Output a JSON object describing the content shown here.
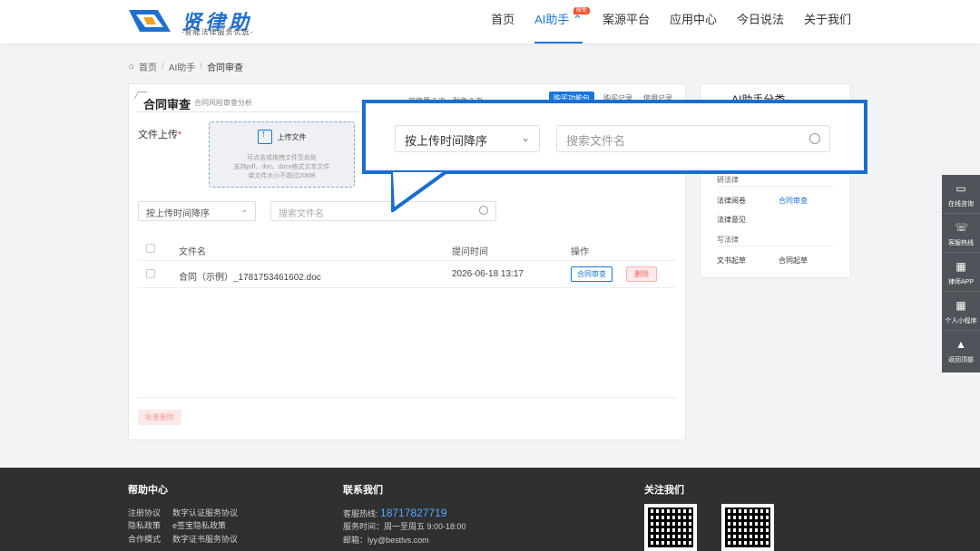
{
  "header": {
    "logo_title": "贤律助",
    "logo_subtitle": "-智能法律服务优选-",
    "nav": [
      {
        "label": "首页",
        "active": false
      },
      {
        "label": "AI助手",
        "active": true,
        "badge": "限免"
      },
      {
        "label": "案源平台",
        "active": false
      },
      {
        "label": "应用中心",
        "active": false
      },
      {
        "label": "今日说法",
        "active": false
      },
      {
        "label": "关于我们",
        "active": false
      }
    ]
  },
  "breadcrumb": {
    "home": "首页",
    "level1": "AI助手",
    "current": "合同审查"
  },
  "main": {
    "title": "合同审查",
    "subtitle": "合同风险审查分析",
    "quota": "可使用 3 次，剩余 2 次",
    "tabs": [
      "购买功能包",
      "购买记录",
      "使用记录"
    ],
    "upload": {
      "label": "文件上传",
      "required_mark": "*",
      "button": "上传文件",
      "hint1": "可点击或拖拽文件至此处",
      "hint2": "支持pdf、doc、docx格式文本文件",
      "hint3": "单文件大小不超过20MB"
    },
    "sort_select": "按上传时间降序",
    "search_placeholder": "搜索文件名",
    "table": {
      "headers": {
        "name": "文件名",
        "time": "提问时间",
        "op": "操作"
      },
      "rows": [
        {
          "name": "合同（示例）_1781753461602.doc",
          "time": "2026-06-18 13:17",
          "review": "合同审查",
          "delete": "删除"
        }
      ]
    },
    "batch_delete": "批量删除"
  },
  "side": {
    "title": "AI助手分类",
    "groups": [
      {
        "label": "研法律",
        "items": [
          [
            "法律阅卷",
            "合同审查"
          ],
          [
            "法律意见",
            ""
          ]
        ]
      },
      {
        "label": "写法律",
        "items": [
          [
            "文书起草",
            "合同起草"
          ]
        ]
      }
    ]
  },
  "callout": {
    "sort_select": "按上传时间降序",
    "search_placeholder": "搜索文件名"
  },
  "float_bar": [
    {
      "icon": "chat-icon",
      "label": "在线咨询"
    },
    {
      "icon": "phone-icon",
      "label": "客服热线"
    },
    {
      "icon": "qr-icon",
      "label": "律师APP"
    },
    {
      "icon": "qr-icon",
      "label": "个人小程序"
    },
    {
      "icon": "rocket-icon",
      "label": "返回顶部"
    }
  ],
  "footer": {
    "help_title": "帮助中心",
    "help_links": [
      "注册协议",
      "数字认证服务协议",
      "隐私政策",
      "e签宝隐私政策",
      "合作模式",
      "数字证书服务协议"
    ],
    "contact_title": "联系我们",
    "hotline_label": "客服热线:",
    "hotline": "18717827719",
    "service_time": "服务时间：周一至周五 9:00-18:00",
    "email": "邮箱：lyy@bestlvs.com",
    "follow_title": "关注我们"
  },
  "colors": {
    "accent": "#1677d9",
    "callout_border": "#1a6ed0",
    "footer_bg": "#2f3032"
  }
}
